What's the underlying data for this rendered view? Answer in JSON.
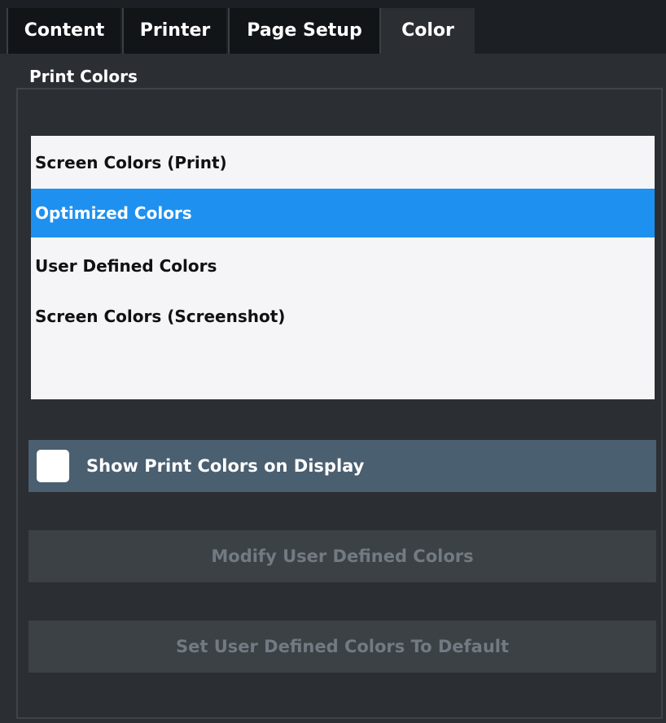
{
  "tabs": [
    {
      "label": "Content"
    },
    {
      "label": "Printer"
    },
    {
      "label": "Page Setup"
    },
    {
      "label": "Color"
    }
  ],
  "active_tab": "Color",
  "section_title": "Print Colors",
  "color_options": [
    {
      "label": "Screen Colors (Print)",
      "selected": false
    },
    {
      "label": "Optimized Colors",
      "selected": true
    },
    {
      "label": "User Defined Colors",
      "selected": false
    },
    {
      "label": "Screen Colors (Screenshot)",
      "selected": false
    }
  ],
  "show_print_colors": {
    "label": "Show Print Colors on Display",
    "checked": false
  },
  "buttons": {
    "modify": "Modify User Defined Colors",
    "set_default": "Set User Defined Colors To Default"
  },
  "colors": {
    "selection": "#1e90f0",
    "background": "#2b2f33"
  }
}
